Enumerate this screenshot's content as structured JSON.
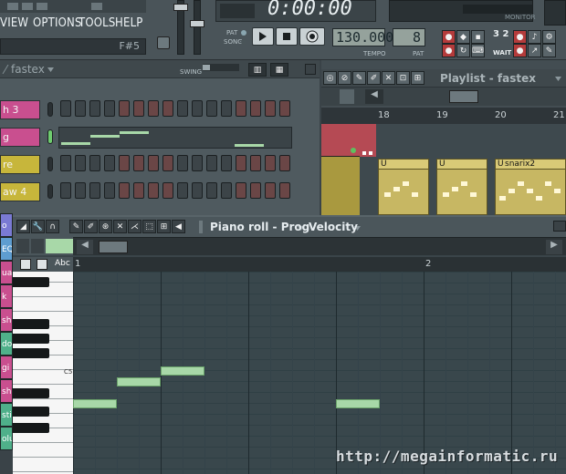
{
  "menu": {
    "items": [
      "VIEW",
      "OPTIONS",
      "TOOLS",
      "HELP"
    ]
  },
  "hint": {
    "text": "F#5"
  },
  "transport": {
    "time": "0:00:00",
    "pat_label": "PAT",
    "song_label": "SONG",
    "tempo_value": "130.000",
    "tempo_label": "TEMPO",
    "pattern_value": "8",
    "pattern_label": "PAT",
    "monitor_label": "MONITOR",
    "wait_label": "WAIT",
    "count_label": "3 2 1"
  },
  "channel_rack": {
    "title": "fastex",
    "swing_label": "SWING",
    "channels": [
      {
        "name": "h 3",
        "color": "#c94f8f"
      },
      {
        "name": "g",
        "color": "#c94f8f"
      },
      {
        "name": "re",
        "color": "#c7b63b"
      },
      {
        "name": "aw 4",
        "color": "#c7b63b"
      }
    ]
  },
  "playlist": {
    "title": "Playlist - fastex",
    "bars": [
      "18",
      "19",
      "20",
      "21"
    ],
    "pattern_label": "snarix2",
    "block_markers": [
      "U",
      "U",
      "U"
    ]
  },
  "piano_roll": {
    "title": "Piano roll - Prog",
    "mode": "Velocity",
    "ruler_marks": [
      "1",
      "2"
    ],
    "key_label": "C5",
    "abc_label": "Abc"
  },
  "left_strip": {
    "tabs": [
      "o",
      "EQ",
      "ua",
      "k",
      "sh",
      "do",
      "gi",
      "sh",
      "sti",
      "olu"
    ],
    "colors": [
      "#7a7ad4",
      "#5e9dd0",
      "#c94f8f",
      "#c94f8f",
      "#c94f8f",
      "#4fb08a",
      "#c94f8f",
      "#c94f8f",
      "#4fb08a",
      "#4fb08a"
    ]
  },
  "watermark": "http://megainformatic.ru",
  "colors": {
    "accent_green": "#a8d8a8",
    "playlist_block": "#c7b763",
    "playlist_red": "#b54a54"
  }
}
